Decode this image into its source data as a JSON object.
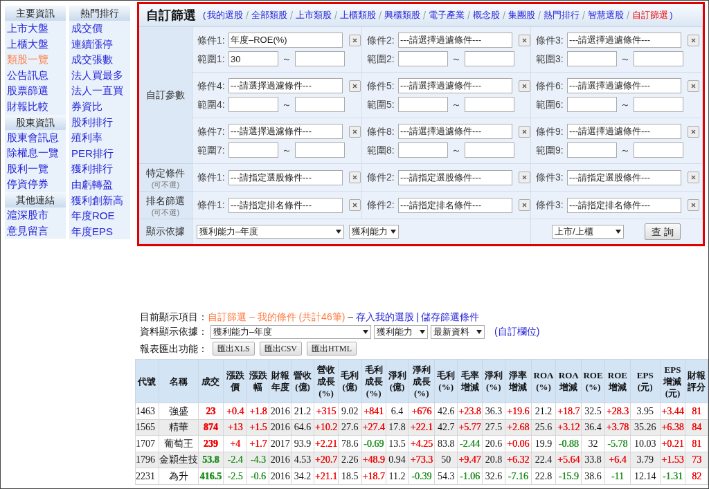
{
  "sidebar": {
    "columns": [
      {
        "groups": [
          {
            "heading": "主要資訊",
            "links": [
              {
                "label": "上市大盤",
                "selected": false
              },
              {
                "label": "上櫃大盤",
                "selected": false
              },
              {
                "label": "類股一覽",
                "selected": true
              },
              {
                "label": "公告訊息",
                "selected": false
              },
              {
                "label": "股票篩選",
                "selected": false
              },
              {
                "label": "財報比較",
                "selected": false
              }
            ]
          },
          {
            "heading": "股東資訊",
            "links": [
              {
                "label": "股東會訊息",
                "selected": false
              },
              {
                "label": "除權息一覽",
                "selected": false
              },
              {
                "label": "股利一覽",
                "selected": false
              },
              {
                "label": "停資停券",
                "selected": false
              }
            ]
          },
          {
            "heading": "其他連結",
            "links": [
              {
                "label": "滬深股市",
                "selected": false
              },
              {
                "label": "意見留言",
                "selected": false
              }
            ]
          }
        ]
      },
      {
        "groups": [
          {
            "heading": "熱門排行",
            "links": [
              {
                "label": "成交價",
                "selected": false
              },
              {
                "label": "連續漲停",
                "selected": false
              },
              {
                "label": "成交張數",
                "selected": false
              },
              {
                "label": "法人買最多",
                "selected": false
              },
              {
                "label": "法人一直買",
                "selected": false
              },
              {
                "label": "券資比",
                "selected": false
              },
              {
                "label": "股利排行",
                "selected": false
              },
              {
                "label": "殖利率",
                "selected": false
              },
              {
                "label": "PER排行",
                "selected": false
              },
              {
                "label": "獲利排行",
                "selected": false
              },
              {
                "label": "由虧轉盈",
                "selected": false
              },
              {
                "label": "獲利創新高",
                "selected": false
              },
              {
                "label": "年度ROE",
                "selected": false
              },
              {
                "label": "年度EPS",
                "selected": false
              }
            ]
          }
        ]
      }
    ]
  },
  "filter_panel": {
    "title": "自訂篩選",
    "open_paren": "(",
    "close_paren": ")",
    "nav": [
      {
        "label": "我的選股",
        "selected": false
      },
      {
        "label": "全部類股",
        "selected": false
      },
      {
        "label": "上市類股",
        "selected": false
      },
      {
        "label": "上櫃類股",
        "selected": false
      },
      {
        "label": "興櫃類股",
        "selected": false
      },
      {
        "label": "電子產業",
        "selected": false
      },
      {
        "label": "概念股",
        "selected": false
      },
      {
        "label": "集團股",
        "selected": false
      },
      {
        "label": "熱門排行",
        "selected": false
      },
      {
        "label": "智慧選股",
        "selected": false
      },
      {
        "label": "自訂篩選",
        "selected": true
      }
    ],
    "custom_params": {
      "label": "自訂參數",
      "conditions": [
        {
          "label": "條件1:",
          "value": "年度–ROE(%)",
          "range_label": "範圍1:",
          "range_from": "30",
          "separator": "～"
        },
        {
          "label": "條件2:",
          "value": "---請選擇過濾條件---",
          "range_label": "範圍2:",
          "separator": "～"
        },
        {
          "label": "條件3:",
          "value": "---請選擇過濾條件---",
          "range_label": "範圍3:",
          "separator": "～"
        },
        {
          "label": "條件4:",
          "value": "---請選擇過濾條件---",
          "range_label": "範圍4:",
          "separator": "～"
        },
        {
          "label": "條件5:",
          "value": "---請選擇過濾條件---",
          "range_label": "範圍5:",
          "separator": "～"
        },
        {
          "label": "條件6:",
          "value": "---請選擇過濾條件---",
          "range_label": "範圍6:",
          "separator": "～"
        },
        {
          "label": "條件7:",
          "value": "---請選擇過濾條件---",
          "range_label": "範圍7:",
          "separator": "～"
        },
        {
          "label": "條件8:",
          "value": "---請選擇過濾條件---",
          "range_label": "範圍8:",
          "separator": "～"
        },
        {
          "label": "條件9:",
          "value": "---請選擇過濾條件---",
          "range_label": "範圍9:",
          "separator": "～"
        }
      ]
    },
    "specific": {
      "label": "特定條件",
      "note": "(可不選)",
      "conditions": [
        {
          "label": "條件1:",
          "value": "---請指定選股條件---"
        },
        {
          "label": "條件2:",
          "value": "---請指定選股條件---"
        },
        {
          "label": "條件3:",
          "value": "---請指定選股條件---"
        }
      ]
    },
    "ranking": {
      "label": "排名篩選",
      "note": "(可不選)",
      "conditions": [
        {
          "label": "條件1:",
          "value": "---請指定排名條件---"
        },
        {
          "label": "條件2:",
          "value": "---請指定排名條件---"
        },
        {
          "label": "條件3:",
          "value": "---請指定排名條件---"
        }
      ]
    },
    "display": {
      "label": "顯示依據",
      "select_1": "獲利能力–年度",
      "select_2": "獲利能力",
      "market": "上市/上櫃",
      "query_button": "查 詢"
    }
  },
  "results": {
    "current_label": "目前顯示項目：",
    "current_value": "自訂篩選 – 我的條件 (共計46筆)",
    "dash": "–",
    "actions": [
      "存入我的選股",
      "儲存篩選條件"
    ],
    "action_separator": "|",
    "basis_label": "資料顯示依據：",
    "basis_select_1": "獲利能力–年度",
    "basis_select_2": "獲利能力",
    "basis_select_3": "最新資料",
    "custom_columns_link": "(自訂欄位)",
    "export_label": "報表匯出功能：",
    "export_buttons": [
      "匯出XLS",
      "匯出CSV",
      "匯出HTML"
    ]
  },
  "table": {
    "columns": [
      "代號",
      "名稱",
      "成交",
      "漲跌價",
      "漲跌幅",
      "財報年度",
      "營收(億)",
      "營收成長(%)",
      "毛利(億)",
      "毛利成長(%)",
      "淨利(億)",
      "淨利成長(%)",
      "毛利(%)",
      "毛率增減",
      "淨利(%)",
      "淨率增減",
      "ROA (%)",
      "ROA增減",
      "ROE (%)",
      "ROE增減",
      "EPS (元)",
      "EPS增減(元)",
      "財報評分"
    ],
    "rows": [
      {
        "cells": [
          {
            "text": "1463"
          },
          {
            "text": "強盛"
          },
          {
            "text": "23",
            "color": "#f00000"
          },
          {
            "text": "+0.4",
            "color": "#f00000"
          },
          {
            "text": "+1.8",
            "color": "#f00000"
          },
          {
            "text": "2016"
          },
          {
            "text": "21.2"
          },
          {
            "text": "+315",
            "color": "#f00000"
          },
          {
            "text": "9.02"
          },
          {
            "text": "+841",
            "color": "#f00000"
          },
          {
            "text": "6.4"
          },
          {
            "text": "+676",
            "color": "#f00000"
          },
          {
            "text": "42.6"
          },
          {
            "text": "+23.8",
            "color": "#f00000"
          },
          {
            "text": "36.3"
          },
          {
            "text": "+19.6",
            "color": "#f00000"
          },
          {
            "text": "21.2"
          },
          {
            "text": "+18.7",
            "color": "#f00000"
          },
          {
            "text": "32.5"
          },
          {
            "text": "+28.3",
            "color": "#f00000"
          },
          {
            "text": "3.95"
          },
          {
            "text": "+3.44",
            "color": "#f00000"
          },
          {
            "text": "81",
            "color": "#f00000"
          }
        ]
      },
      {
        "cells": [
          {
            "text": "1565"
          },
          {
            "text": "精華"
          },
          {
            "text": "874",
            "color": "#f00000"
          },
          {
            "text": "+13",
            "color": "#f00000"
          },
          {
            "text": "+1.5",
            "color": "#f00000"
          },
          {
            "text": "2016"
          },
          {
            "text": "64.6"
          },
          {
            "text": "+10.2",
            "color": "#f00000"
          },
          {
            "text": "27.6"
          },
          {
            "text": "+27.4",
            "color": "#f00000"
          },
          {
            "text": "17.8"
          },
          {
            "text": "+22.1",
            "color": "#f00000"
          },
          {
            "text": "42.7"
          },
          {
            "text": "+5.77",
            "color": "#f00000"
          },
          {
            "text": "27.5"
          },
          {
            "text": "+2.68",
            "color": "#f00000"
          },
          {
            "text": "25.6"
          },
          {
            "text": "+3.12",
            "color": "#f00000"
          },
          {
            "text": "36.4"
          },
          {
            "text": "+3.78",
            "color": "#f00000"
          },
          {
            "text": "35.26"
          },
          {
            "text": "+6.38",
            "color": "#f00000"
          },
          {
            "text": "84",
            "color": "#f00000"
          }
        ]
      },
      {
        "cells": [
          {
            "text": "1707"
          },
          {
            "text": "葡萄王"
          },
          {
            "text": "239",
            "color": "#f00000"
          },
          {
            "text": "+4",
            "color": "#f00000"
          },
          {
            "text": "+1.7",
            "color": "#f00000"
          },
          {
            "text": "2017"
          },
          {
            "text": "93.9"
          },
          {
            "text": "+2.21",
            "color": "#f00000"
          },
          {
            "text": "78.6"
          },
          {
            "text": "-0.69",
            "color": "#1f8f1f"
          },
          {
            "text": "13.5"
          },
          {
            "text": "+4.25",
            "color": "#f00000"
          },
          {
            "text": "83.8"
          },
          {
            "text": "-2.44",
            "color": "#1f8f1f"
          },
          {
            "text": "20.6"
          },
          {
            "text": "+0.06",
            "color": "#f00000"
          },
          {
            "text": "19.9"
          },
          {
            "text": "-0.88",
            "color": "#1f8f1f"
          },
          {
            "text": "32"
          },
          {
            "text": "-5.78",
            "color": "#1f8f1f"
          },
          {
            "text": "10.03"
          },
          {
            "text": "+0.21",
            "color": "#f00000"
          },
          {
            "text": "81",
            "color": "#f00000"
          }
        ]
      },
      {
        "cells": [
          {
            "text": "1796"
          },
          {
            "text": "金穎生技"
          },
          {
            "text": "53.8",
            "color": "#1f8f1f"
          },
          {
            "text": "-2.4",
            "color": "#1f8f1f"
          },
          {
            "text": "-4.3",
            "color": "#1f8f1f"
          },
          {
            "text": "2016"
          },
          {
            "text": "4.53"
          },
          {
            "text": "+20.7",
            "color": "#f00000"
          },
          {
            "text": "2.26"
          },
          {
            "text": "+48.9",
            "color": "#f00000"
          },
          {
            "text": "0.94"
          },
          {
            "text": "+73.3",
            "color": "#f00000"
          },
          {
            "text": "50"
          },
          {
            "text": "+9.47",
            "color": "#f00000"
          },
          {
            "text": "20.8"
          },
          {
            "text": "+6.32",
            "color": "#f00000"
          },
          {
            "text": "22.4"
          },
          {
            "text": "+5.64",
            "color": "#f00000"
          },
          {
            "text": "33.8"
          },
          {
            "text": "+6.4",
            "color": "#f00000"
          },
          {
            "text": "3.79"
          },
          {
            "text": "+1.53",
            "color": "#f00000"
          },
          {
            "text": "73",
            "color": "#f00000"
          }
        ]
      },
      {
        "cells": [
          {
            "text": "2231"
          },
          {
            "text": "為升"
          },
          {
            "text": "416.5",
            "color": "#1f8f1f"
          },
          {
            "text": "-2.5",
            "color": "#1f8f1f"
          },
          {
            "text": "-0.6",
            "color": "#1f8f1f"
          },
          {
            "text": "2016"
          },
          {
            "text": "34.2"
          },
          {
            "text": "+21.1",
            "color": "#f00000"
          },
          {
            "text": "18.5"
          },
          {
            "text": "+18.7",
            "color": "#f00000"
          },
          {
            "text": "11.2"
          },
          {
            "text": "-0.39",
            "color": "#1f8f1f"
          },
          {
            "text": "54.3"
          },
          {
            "text": "-1.06",
            "color": "#1f8f1f"
          },
          {
            "text": "32.6"
          },
          {
            "text": "-7.16",
            "color": "#1f8f1f"
          },
          {
            "text": "22.8"
          },
          {
            "text": "-15.9",
            "color": "#1f8f1f"
          },
          {
            "text": "38.6"
          },
          {
            "text": "-11",
            "color": "#1f8f1f"
          },
          {
            "text": "12.14"
          },
          {
            "text": "-1.31",
            "color": "#1f8f1f"
          },
          {
            "text": "82",
            "color": "#f00000"
          }
        ]
      }
    ]
  }
}
